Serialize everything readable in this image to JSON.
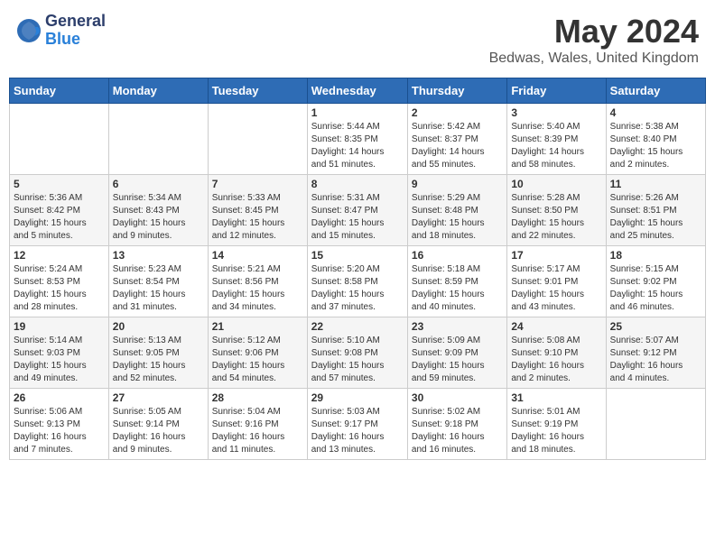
{
  "header": {
    "logo_general": "General",
    "logo_blue": "Blue",
    "month_title": "May 2024",
    "location": "Bedwas, Wales, United Kingdom"
  },
  "days_of_week": [
    "Sunday",
    "Monday",
    "Tuesday",
    "Wednesday",
    "Thursday",
    "Friday",
    "Saturday"
  ],
  "weeks": [
    [
      {
        "day": "",
        "info": ""
      },
      {
        "day": "",
        "info": ""
      },
      {
        "day": "",
        "info": ""
      },
      {
        "day": "1",
        "info": "Sunrise: 5:44 AM\nSunset: 8:35 PM\nDaylight: 14 hours\nand 51 minutes."
      },
      {
        "day": "2",
        "info": "Sunrise: 5:42 AM\nSunset: 8:37 PM\nDaylight: 14 hours\nand 55 minutes."
      },
      {
        "day": "3",
        "info": "Sunrise: 5:40 AM\nSunset: 8:39 PM\nDaylight: 14 hours\nand 58 minutes."
      },
      {
        "day": "4",
        "info": "Sunrise: 5:38 AM\nSunset: 8:40 PM\nDaylight: 15 hours\nand 2 minutes."
      }
    ],
    [
      {
        "day": "5",
        "info": "Sunrise: 5:36 AM\nSunset: 8:42 PM\nDaylight: 15 hours\nand 5 minutes."
      },
      {
        "day": "6",
        "info": "Sunrise: 5:34 AM\nSunset: 8:43 PM\nDaylight: 15 hours\nand 9 minutes."
      },
      {
        "day": "7",
        "info": "Sunrise: 5:33 AM\nSunset: 8:45 PM\nDaylight: 15 hours\nand 12 minutes."
      },
      {
        "day": "8",
        "info": "Sunrise: 5:31 AM\nSunset: 8:47 PM\nDaylight: 15 hours\nand 15 minutes."
      },
      {
        "day": "9",
        "info": "Sunrise: 5:29 AM\nSunset: 8:48 PM\nDaylight: 15 hours\nand 18 minutes."
      },
      {
        "day": "10",
        "info": "Sunrise: 5:28 AM\nSunset: 8:50 PM\nDaylight: 15 hours\nand 22 minutes."
      },
      {
        "day": "11",
        "info": "Sunrise: 5:26 AM\nSunset: 8:51 PM\nDaylight: 15 hours\nand 25 minutes."
      }
    ],
    [
      {
        "day": "12",
        "info": "Sunrise: 5:24 AM\nSunset: 8:53 PM\nDaylight: 15 hours\nand 28 minutes."
      },
      {
        "day": "13",
        "info": "Sunrise: 5:23 AM\nSunset: 8:54 PM\nDaylight: 15 hours\nand 31 minutes."
      },
      {
        "day": "14",
        "info": "Sunrise: 5:21 AM\nSunset: 8:56 PM\nDaylight: 15 hours\nand 34 minutes."
      },
      {
        "day": "15",
        "info": "Sunrise: 5:20 AM\nSunset: 8:58 PM\nDaylight: 15 hours\nand 37 minutes."
      },
      {
        "day": "16",
        "info": "Sunrise: 5:18 AM\nSunset: 8:59 PM\nDaylight: 15 hours\nand 40 minutes."
      },
      {
        "day": "17",
        "info": "Sunrise: 5:17 AM\nSunset: 9:01 PM\nDaylight: 15 hours\nand 43 minutes."
      },
      {
        "day": "18",
        "info": "Sunrise: 5:15 AM\nSunset: 9:02 PM\nDaylight: 15 hours\nand 46 minutes."
      }
    ],
    [
      {
        "day": "19",
        "info": "Sunrise: 5:14 AM\nSunset: 9:03 PM\nDaylight: 15 hours\nand 49 minutes."
      },
      {
        "day": "20",
        "info": "Sunrise: 5:13 AM\nSunset: 9:05 PM\nDaylight: 15 hours\nand 52 minutes."
      },
      {
        "day": "21",
        "info": "Sunrise: 5:12 AM\nSunset: 9:06 PM\nDaylight: 15 hours\nand 54 minutes."
      },
      {
        "day": "22",
        "info": "Sunrise: 5:10 AM\nSunset: 9:08 PM\nDaylight: 15 hours\nand 57 minutes."
      },
      {
        "day": "23",
        "info": "Sunrise: 5:09 AM\nSunset: 9:09 PM\nDaylight: 15 hours\nand 59 minutes."
      },
      {
        "day": "24",
        "info": "Sunrise: 5:08 AM\nSunset: 9:10 PM\nDaylight: 16 hours\nand 2 minutes."
      },
      {
        "day": "25",
        "info": "Sunrise: 5:07 AM\nSunset: 9:12 PM\nDaylight: 16 hours\nand 4 minutes."
      }
    ],
    [
      {
        "day": "26",
        "info": "Sunrise: 5:06 AM\nSunset: 9:13 PM\nDaylight: 16 hours\nand 7 minutes."
      },
      {
        "day": "27",
        "info": "Sunrise: 5:05 AM\nSunset: 9:14 PM\nDaylight: 16 hours\nand 9 minutes."
      },
      {
        "day": "28",
        "info": "Sunrise: 5:04 AM\nSunset: 9:16 PM\nDaylight: 16 hours\nand 11 minutes."
      },
      {
        "day": "29",
        "info": "Sunrise: 5:03 AM\nSunset: 9:17 PM\nDaylight: 16 hours\nand 13 minutes."
      },
      {
        "day": "30",
        "info": "Sunrise: 5:02 AM\nSunset: 9:18 PM\nDaylight: 16 hours\nand 16 minutes."
      },
      {
        "day": "31",
        "info": "Sunrise: 5:01 AM\nSunset: 9:19 PM\nDaylight: 16 hours\nand 18 minutes."
      },
      {
        "day": "",
        "info": ""
      }
    ]
  ]
}
